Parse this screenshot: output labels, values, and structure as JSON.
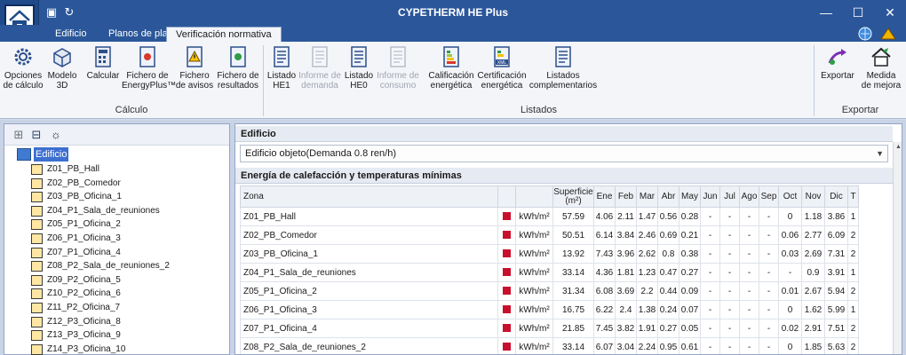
{
  "window": {
    "title": "CYPETHERM HE Plus",
    "controls": {
      "minimize": "—",
      "maximize": "☐",
      "close": "✕"
    }
  },
  "tabs": [
    {
      "label": "Edificio",
      "active": false
    },
    {
      "label": "Planos de planta",
      "active": false
    },
    {
      "label": "Verificación normativa",
      "active": true
    }
  ],
  "ribbon": {
    "groups": {
      "calculo": "Cálculo",
      "listados": "Listados",
      "exportar": "Exportar"
    },
    "buttons": {
      "opciones": "Opciones\nde cálculo",
      "modelo3d": "Modelo\n3D",
      "calcular": "Calcular",
      "fichero_energyplus": "Fichero de\nEnergyPlus™",
      "fichero_avisos": "Fichero\nde avisos",
      "fichero_resultados": "Fichero de\nresultados",
      "listado_he1": "Listado\nHE1",
      "informe_demanda": "Informe de\ndemanda",
      "listado_he0": "Listado\nHE0",
      "informe_consumo": "Informe de\nconsumo",
      "calificacion": "Calificación\nenergética",
      "certificacion": "Certificación\nenergética",
      "listados_compl": "Listados\ncomplementarios",
      "exportar": "Exportar",
      "medida_mejora": "Medida\nde mejora",
      "xml_badge": "XML"
    }
  },
  "tree": {
    "root": "Edificio",
    "items": [
      "Z01_PB_Hall",
      "Z02_PB_Comedor",
      "Z03_PB_Oficina_1",
      "Z04_P1_Sala_de_reuniones",
      "Z05_P1_Oficina_2",
      "Z06_P1_Oficina_3",
      "Z07_P1_Oficina_4",
      "Z08_P2_Sala_de_reuniones_2",
      "Z09_P2_Oficina_5",
      "Z10_P2_Oficina_6",
      "Z11_P2_Oficina_7",
      "Z12_P3_Oficina_8",
      "Z13_P3_Oficina_9",
      "Z14_P3_Oficina_10"
    ]
  },
  "main": {
    "header": "Edificio",
    "dropdown_value": "Edificio objeto(Demanda 0.8 ren/h)",
    "section_title": "Energía de calefacción y temperaturas mínimas",
    "columns": {
      "zona": "Zona",
      "superficie": "Superficie",
      "superficie_unit": "(m²)",
      "months": [
        "Ene",
        "Feb",
        "Mar",
        "Abr",
        "May",
        "Jun",
        "Jul",
        "Ago",
        "Sep",
        "Oct",
        "Nov",
        "Dic",
        "T"
      ]
    },
    "unit": "kWh/m²",
    "swatch_color": "#c8102e",
    "rows": [
      {
        "zona": "Z01_PB_Hall",
        "sup": "57.59",
        "m": [
          "4.06",
          "2.11",
          "1.47",
          "0.56",
          "0.28",
          "-",
          "-",
          "-",
          "-",
          "0",
          "1.18",
          "3.86",
          "1"
        ]
      },
      {
        "zona": "Z02_PB_Comedor",
        "sup": "50.51",
        "m": [
          "6.14",
          "3.84",
          "2.46",
          "0.69",
          "0.21",
          "-",
          "-",
          "-",
          "-",
          "0.06",
          "2.77",
          "6.09",
          "2"
        ]
      },
      {
        "zona": "Z03_PB_Oficina_1",
        "sup": "13.92",
        "m": [
          "7.43",
          "3.96",
          "2.62",
          "0.8",
          "0.38",
          "-",
          "-",
          "-",
          "-",
          "0.03",
          "2.69",
          "7.31",
          "2"
        ]
      },
      {
        "zona": "Z04_P1_Sala_de_reuniones",
        "sup": "33.14",
        "m": [
          "4.36",
          "1.81",
          "1.23",
          "0.47",
          "0.27",
          "-",
          "-",
          "-",
          "-",
          "-",
          "0.9",
          "3.91",
          "1"
        ]
      },
      {
        "zona": "Z05_P1_Oficina_2",
        "sup": "31.34",
        "m": [
          "6.08",
          "3.69",
          "2.2",
          "0.44",
          "0.09",
          "-",
          "-",
          "-",
          "-",
          "0.01",
          "2.67",
          "5.94",
          "2"
        ]
      },
      {
        "zona": "Z06_P1_Oficina_3",
        "sup": "16.75",
        "m": [
          "6.22",
          "2.4",
          "1.38",
          "0.24",
          "0.07",
          "-",
          "-",
          "-",
          "-",
          "0",
          "1.62",
          "5.99",
          "1"
        ]
      },
      {
        "zona": "Z07_P1_Oficina_4",
        "sup": "21.85",
        "m": [
          "7.45",
          "3.82",
          "1.91",
          "0.27",
          "0.05",
          "-",
          "-",
          "-",
          "-",
          "0.02",
          "2.91",
          "7.51",
          "2"
        ]
      },
      {
        "zona": "Z08_P2_Sala_de_reuniones_2",
        "sup": "33.14",
        "m": [
          "6.07",
          "3.04",
          "2.24",
          "0.95",
          "0.61",
          "-",
          "-",
          "-",
          "-",
          "0",
          "1.85",
          "5.63",
          "2"
        ]
      }
    ]
  }
}
